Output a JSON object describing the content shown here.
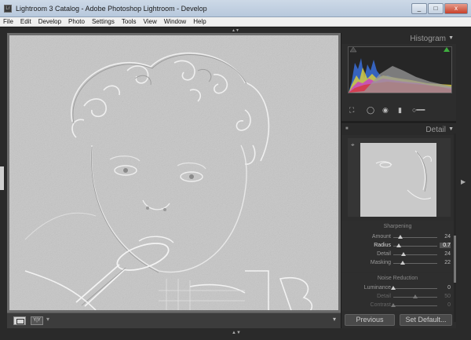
{
  "window": {
    "app_icon_text": "Lr",
    "title": "Lightroom 3 Catalog - Adobe Photoshop Lightroom - Develop",
    "controls": {
      "minimize": "_",
      "maximize": "□",
      "close": "x"
    }
  },
  "menu": [
    "File",
    "Edit",
    "Develop",
    "Photo",
    "Settings",
    "Tools",
    "View",
    "Window",
    "Help"
  ],
  "toolbar": {
    "before_after_label": "Y|Y",
    "dropdown_glyph": "▾",
    "right_glyph": "▾"
  },
  "right_panel": {
    "histogram": {
      "title": "Histogram"
    },
    "detail": {
      "title": "Detail",
      "sharpening": {
        "title": "Sharpening",
        "rows": [
          {
            "label": "Amount",
            "value": "24",
            "fraction": 0.16,
            "active": false
          },
          {
            "label": "Radius",
            "value": "0.7",
            "fraction": 0.12,
            "active": true
          },
          {
            "label": "Detail",
            "value": "24",
            "fraction": 0.24,
            "active": false
          },
          {
            "label": "Masking",
            "value": "22",
            "fraction": 0.22,
            "active": false
          }
        ]
      },
      "noise_reduction": {
        "title": "Noise Reduction",
        "rows": [
          {
            "label": "Luminance",
            "value": "0",
            "fraction": 0.0,
            "dim": false
          },
          {
            "label": "Detail",
            "value": "50",
            "fraction": 0.5,
            "dim": true
          },
          {
            "label": "Contrast",
            "value": "0",
            "fraction": 0.0,
            "dim": true
          }
        ]
      }
    },
    "buttons": {
      "previous": "Previous",
      "set_default": "Set Default..."
    }
  },
  "colors": {
    "panel_bg": "#2d2d2d",
    "canvas_bg": "#6b6b6b",
    "title_blue": "#c5d4e6"
  }
}
